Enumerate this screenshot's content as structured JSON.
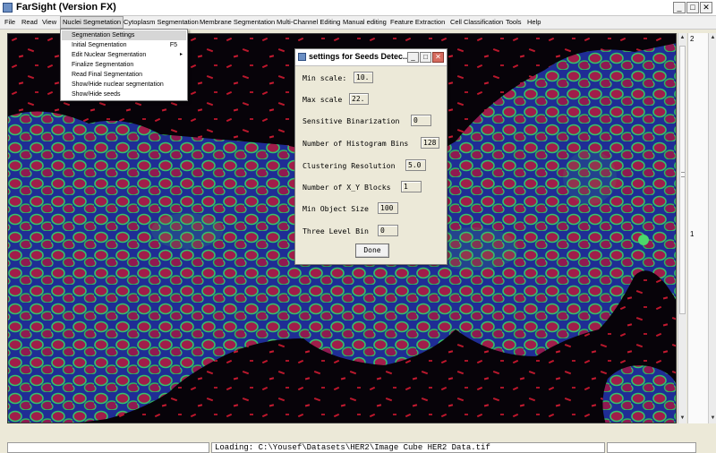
{
  "window": {
    "title": "FarSight (Version FX)",
    "minimize": "_",
    "maximize": "□",
    "close": "✕"
  },
  "menubar": {
    "items": [
      "File",
      "Read",
      "View",
      "Nuclei Segmetation",
      "Cytoplasm Segmentation",
      "Membrane Segmentation",
      "Multi-Channel Editing",
      "Manual editing",
      "Feature Extraction",
      "Cell Classification",
      "Tools",
      "Help"
    ],
    "active_index": 3
  },
  "dropdown": {
    "items": [
      {
        "label": "Segmentation Settings",
        "shortcut": "",
        "submenu": false,
        "highlighted": true
      },
      {
        "label": "Initial Segmentation",
        "shortcut": "F5",
        "submenu": false,
        "highlighted": false
      },
      {
        "label": "Edit Nuclear Segmentation",
        "shortcut": "",
        "submenu": true,
        "highlighted": false
      },
      {
        "label": "Finalize Segmentation",
        "shortcut": "",
        "submenu": false,
        "highlighted": false
      },
      {
        "label": "Read Final Segmentation",
        "shortcut": "",
        "submenu": false,
        "highlighted": false
      },
      {
        "label": "Show/Hide nuclear segmentation",
        "shortcut": "",
        "submenu": false,
        "highlighted": false
      },
      {
        "label": "Show/Hide seeds",
        "shortcut": "",
        "submenu": false,
        "highlighted": false
      }
    ],
    "submenu_arrow": "▸"
  },
  "dialog": {
    "title": "settings for Seeds Detec...",
    "fields": [
      {
        "label": "Min scale:",
        "value": "10."
      },
      {
        "label": "Max scale",
        "value": "22."
      },
      {
        "label": "Sensitive Binarization",
        "value": "0"
      },
      {
        "label": "Number of Histogram Bins",
        "value": "128"
      },
      {
        "label": "Clustering Resolution",
        "value": "5.0"
      },
      {
        "label": "Number of X_Y Blocks",
        "value": "1"
      },
      {
        "label": "Min Object Size",
        "value": "100"
      },
      {
        "label": "Three Level Bin",
        "value": "0"
      }
    ],
    "done_label": "Done"
  },
  "side_panel": {
    "top_number": "2",
    "mid_number": "1"
  },
  "status": {
    "log_text": "Loading: C:\\Yousef\\Datasets\\HER2\\Image Cube HER2 Data.tif"
  },
  "image": {
    "description_icon": "microscopy-image",
    "colors": {
      "nuclei": "#c2203e",
      "membrane": "#3fc266",
      "dapi": "#2b3fa8",
      "background": "#060308"
    }
  }
}
